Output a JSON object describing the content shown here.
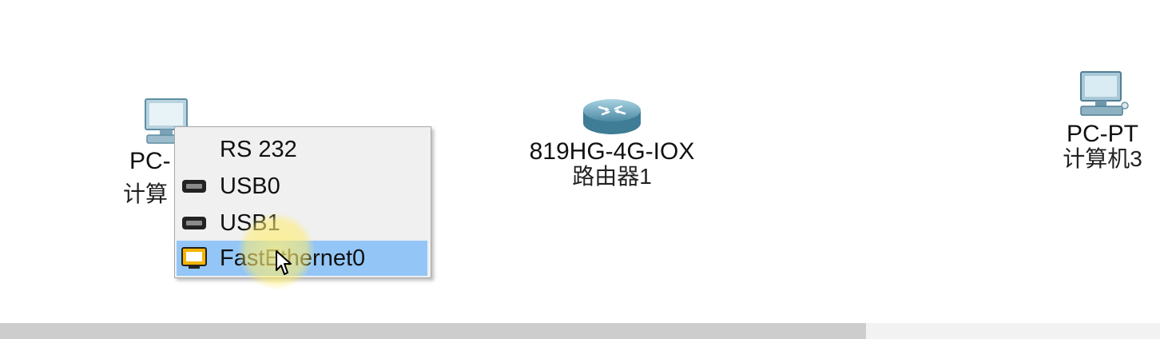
{
  "devices": {
    "pc_left": {
      "model": "PC-",
      "name": "计算",
      "icon": "computer-icon"
    },
    "router": {
      "model": "819HG-4G-IOX",
      "name": "路由器1",
      "icon": "router-icon"
    },
    "pc_right": {
      "model": "PC-PT",
      "name": "计算机3",
      "icon": "computer-icon"
    }
  },
  "port_menu": {
    "items": [
      {
        "label": "RS 232",
        "icon": "none",
        "selected": false
      },
      {
        "label": "USB0",
        "icon": "usb-port-icon",
        "selected": false
      },
      {
        "label": "USB1",
        "icon": "usb-port-icon",
        "selected": false
      },
      {
        "label": "FastEthernet0",
        "icon": "ethernet-port-icon",
        "selected": true
      }
    ],
    "selected_color": "#93c6f7"
  },
  "colors": {
    "background": "#ffffff",
    "menu_background": "#f0f0f0",
    "cursor_highlight": "#ffec6e",
    "scrollbar_thumb": "#cdcdcd"
  }
}
